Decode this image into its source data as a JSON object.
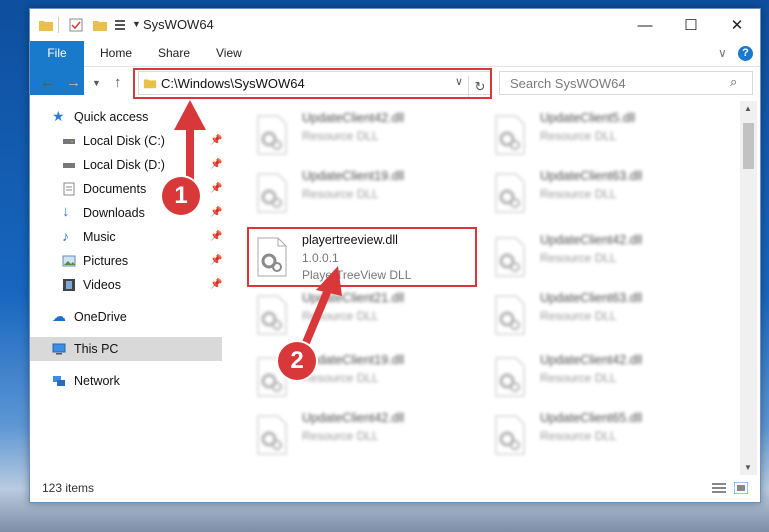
{
  "window": {
    "title": "SysWOW64",
    "minimize_glyph": "—",
    "maximize_glyph": "☐",
    "close_glyph": "✕"
  },
  "ribbon": {
    "tabs": [
      "File",
      "Home",
      "Share",
      "View"
    ],
    "help_glyph": "?",
    "expand_glyph": "∨"
  },
  "address": {
    "path": "C:\\Windows\\SysWOW64",
    "search_placeholder": "Search SysWOW64"
  },
  "nav": {
    "items": [
      {
        "label": "Quick access",
        "icon": "star-icon"
      },
      {
        "label": "Local Disk (C:)",
        "icon": "drive-icon",
        "pinned": true
      },
      {
        "label": "Local Disk (D:)",
        "icon": "drive-icon",
        "pinned": true
      },
      {
        "label": "Documents",
        "icon": "documents-icon",
        "pinned": true
      },
      {
        "label": "Downloads",
        "icon": "download-icon",
        "pinned": true
      },
      {
        "label": "Music",
        "icon": "music-icon",
        "pinned": true
      },
      {
        "label": "Pictures",
        "icon": "pictures-icon",
        "pinned": true
      },
      {
        "label": "Videos",
        "icon": "videos-icon",
        "pinned": true
      },
      {
        "label": "OneDrive",
        "icon": "cloud-icon"
      },
      {
        "label": "This PC",
        "icon": "pc-icon",
        "selected": true
      },
      {
        "label": "Network",
        "icon": "network-icon"
      }
    ]
  },
  "files": [
    {
      "name": "UpdateClient42.dll",
      "type": "Resource DLL"
    },
    {
      "name": "UpdateClient5.dll",
      "type": "Resource DLL"
    },
    {
      "name": "UpdateClient19.dll",
      "type": "Resource DLL"
    },
    {
      "name": "UpdateClient63.dll",
      "type": "Resource DLL"
    },
    {
      "name": "playertreeview.dll",
      "version": "1.0.0.1",
      "type": "PlayerTreeView DLL"
    },
    {
      "name": "UpdateClient42.dll",
      "type": "Resource DLL"
    },
    {
      "name": "UpdateClient21.dll",
      "type": "Resource DLL"
    },
    {
      "name": "UpdateClient63.dll",
      "type": "Resource DLL"
    },
    {
      "name": "UpdateClient19.dll",
      "type": "Resource DLL"
    },
    {
      "name": "UpdateClient42.dll",
      "type": "Resource DLL"
    },
    {
      "name": "UpdateClient42.dll",
      "type": "Resource DLL"
    },
    {
      "name": "UpdateClient65.dll",
      "type": "Resource DLL"
    }
  ],
  "status": {
    "count": "123 items"
  },
  "annotations": {
    "step1": "1",
    "step2": "2"
  },
  "colors": {
    "accent": "#1979ca",
    "highlight": "#d9383a"
  }
}
